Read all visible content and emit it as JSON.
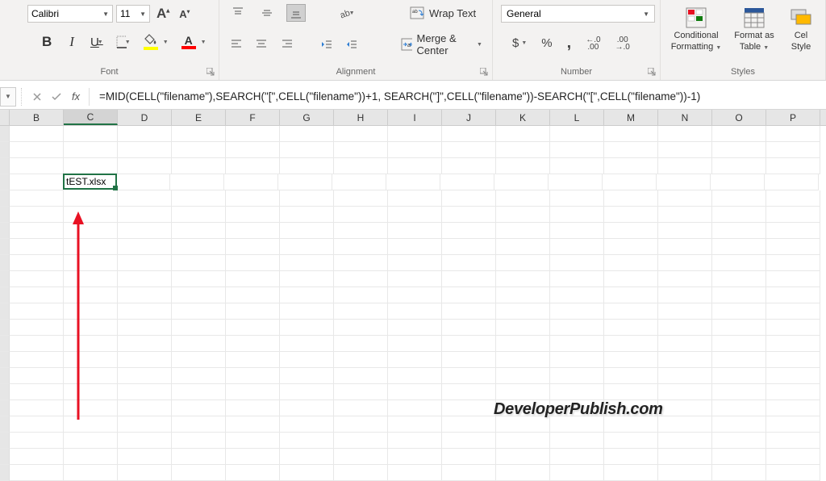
{
  "ribbon": {
    "font": {
      "label": "Font",
      "font_name": "Calibri",
      "font_size": "11",
      "bold": "B",
      "italic": "I",
      "underline": "U",
      "inc_a": "A",
      "dec_a": "A",
      "fill_letter": "A",
      "color_a": "A"
    },
    "alignment": {
      "label": "Alignment",
      "wrap_text": "Wrap Text",
      "merge_center": "Merge & Center"
    },
    "number": {
      "label": "Number",
      "format": "General",
      "currency": "$",
      "percent": "%",
      "comma": ",",
      "inc_dec_icon1": ".0",
      "inc_dec_icon2": ".00"
    },
    "styles": {
      "label": "Styles",
      "conditional_l1": "Conditional",
      "conditional_l2": "Formatting",
      "table_l1": "Format as",
      "table_l2": "Table",
      "cell_l1": "Cel",
      "cell_l2": "Style"
    }
  },
  "formula_bar": {
    "fx": "fx",
    "value": "=MID(CELL(\"filename\"),SEARCH(\"[\",CELL(\"filename\"))+1, SEARCH(\"]\",CELL(\"filename\"))-SEARCH(\"[\",CELL(\"filename\"))-1)"
  },
  "columns": [
    "B",
    "C",
    "D",
    "E",
    "F",
    "G",
    "H",
    "I",
    "J",
    "K",
    "L",
    "M",
    "N",
    "O",
    "P"
  ],
  "active_cell": {
    "col": "C",
    "row": 4,
    "value": "tEST.xlsx"
  },
  "watermark": "DeveloperPublish.com"
}
